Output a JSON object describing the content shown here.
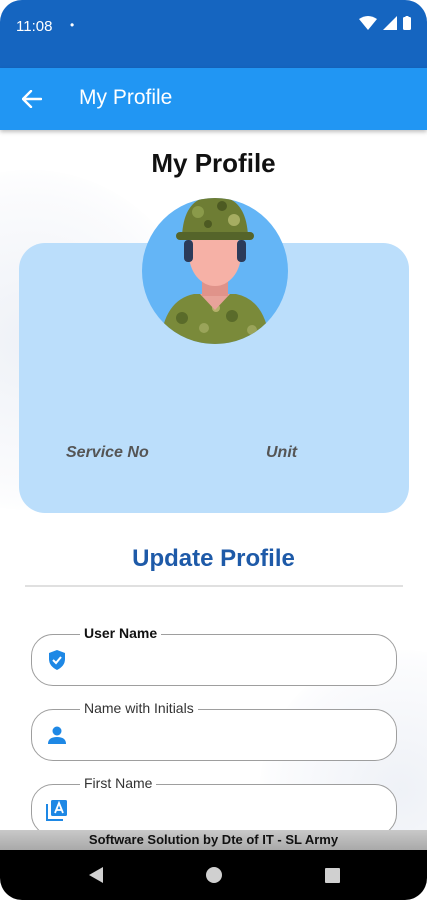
{
  "status_bar": {
    "time": "11:08",
    "dot": "•"
  },
  "app_bar": {
    "title": "My Profile"
  },
  "page": {
    "title": "My Profile"
  },
  "profile_card": {
    "service_no_label": "Service No",
    "unit_label": "Unit"
  },
  "update_section": {
    "title": "Update Profile"
  },
  "fields": [
    {
      "label": "User Name",
      "value": "",
      "icon": "verified-shield-icon"
    },
    {
      "label": "Name with Initials",
      "value": "",
      "icon": "person-icon"
    },
    {
      "label": "First Name",
      "value": "",
      "icon": "font-letter-icon"
    }
  ],
  "footer": {
    "text": "Software Solution by Dte of IT - SL Army"
  },
  "colors": {
    "status_bar": "#1565c0",
    "app_bar": "#2196f3",
    "card": "#bbdefb",
    "section_title": "#1e5aa8"
  }
}
